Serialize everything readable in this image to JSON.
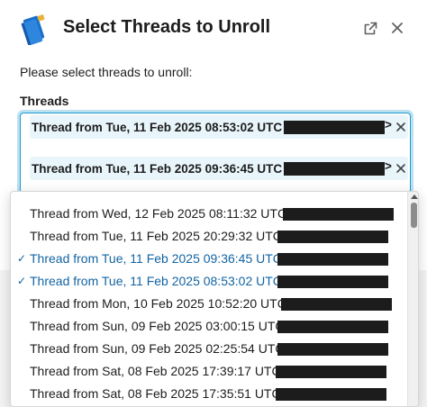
{
  "modal": {
    "title": "Select Threads to Unroll",
    "prompt": "Please select threads to unroll:",
    "field_label": "Threads"
  },
  "selected_chips": [
    {
      "label": "Thread from Tue, 11 Feb 2025 08:53:02 UTC <",
      "suffix": ">"
    },
    {
      "label": "Thread from Tue, 11 Feb 2025 09:36:45 UTC <",
      "suffix": ">"
    }
  ],
  "options": [
    {
      "label": "Thread from Wed, 12 Feb 2025 08:11:32 UTC",
      "selected": false
    },
    {
      "label": "Thread from Tue, 11 Feb 2025 20:29:32 UTC",
      "selected": false
    },
    {
      "label": "Thread from Tue, 11 Feb 2025 09:36:45 UTC",
      "selected": true
    },
    {
      "label": "Thread from Tue, 11 Feb 2025 08:53:02 UTC",
      "selected": true
    },
    {
      "label": "Thread from Mon, 10 Feb 2025 10:52:20 UTC",
      "selected": false
    },
    {
      "label": "Thread from Sun, 09 Feb 2025 03:00:15 UTC",
      "selected": false
    },
    {
      "label": "Thread from Sun, 09 Feb 2025 02:25:54 UTC",
      "selected": false
    },
    {
      "label": "Thread from Sat, 08 Feb 2025 17:39:17 UTC",
      "selected": false
    },
    {
      "label": "Thread from Sat, 08 Feb 2025 17:35:51 UTC",
      "selected": false
    }
  ],
  "check_glyph": "✓",
  "colors": {
    "accent": "#1264a3",
    "focus_ring": "#1d9bd1",
    "chip_bg": "#e8f5fa",
    "redaction": "#1d1c1d"
  },
  "icons": {
    "app": "blue-books-icon",
    "open_external": "open-in-new-window-icon",
    "close": "close-icon",
    "chip_remove": "remove-x-icon",
    "check": "checkmark-icon"
  }
}
